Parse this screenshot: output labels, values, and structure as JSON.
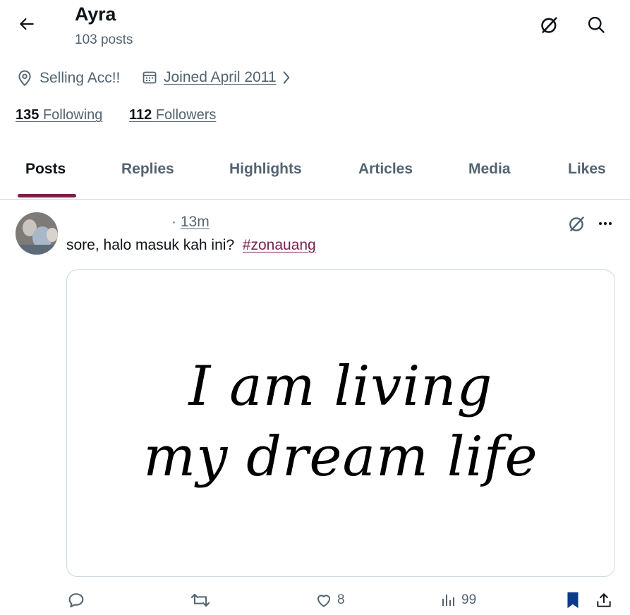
{
  "header": {
    "name": "Ayra",
    "post_count": "103 posts",
    "icons": {
      "back": "back-arrow-icon",
      "grok": "grok-icon",
      "search": "search-icon"
    }
  },
  "profile": {
    "location": "Selling Acc!!",
    "joined": "Joined April 2011",
    "following_count": "135",
    "following_label": "Following",
    "followers_count": "112",
    "followers_label": "Followers"
  },
  "tabs": [
    {
      "label": "Posts",
      "active": true
    },
    {
      "label": "Replies"
    },
    {
      "label": "Highlights"
    },
    {
      "label": "Articles"
    },
    {
      "label": "Media"
    },
    {
      "label": "Likes"
    }
  ],
  "post": {
    "time_sep": "·",
    "time": "13m",
    "text": "sore, halo masuk kah ini?  ",
    "hashtag": "#zonauang",
    "media_text": [
      "I am living",
      "my dream life"
    ],
    "actions": {
      "likes": "8",
      "views": "99",
      "bookmarked": true
    }
  },
  "colors": {
    "accent": "#7b1f4b",
    "text_primary": "#0f1419",
    "text_secondary": "#536471",
    "bookmark": "#0c3a8a",
    "divider": "#cfd9de"
  }
}
